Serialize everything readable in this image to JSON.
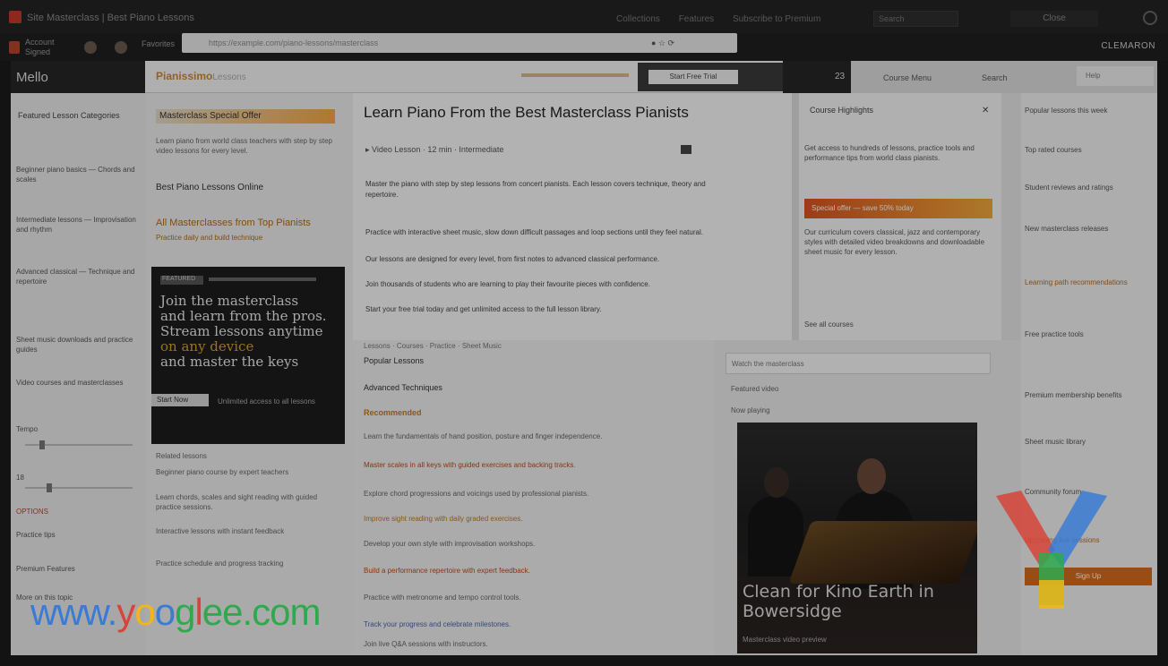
{
  "browser": {
    "tab_title": "Site Masterclass | Best Piano Lessons",
    "top_links": [
      "Collections",
      "Features",
      "Subscribe to Premium"
    ],
    "search_text": "Search",
    "right_button": "Close",
    "user_label": "Account",
    "user_sub": "Signed",
    "crumb": "Favorites",
    "url_text": "https://example.com/piano-lessons/masterclass",
    "url_icons": "● ☆ ⟳",
    "brand_right": "CLEMARON"
  },
  "nav": {
    "menu_label": "Mello",
    "right_link_1": "Course Menu",
    "right_link_2": "Search",
    "right_box": "Help",
    "number": "23"
  },
  "site_header": {
    "logo": "Pianissimo",
    "logo_tag": "Lessons",
    "button": "Start Free Trial"
  },
  "left_sidebar": {
    "title": "Featured Lesson Categories",
    "items": [
      "Beginner piano basics — Chords and scales",
      "Intermediate lessons — Improvisation and rhythm",
      "Advanced classical — Technique and repertoire",
      "Sheet music downloads and practice guides",
      "Video courses and masterclasses",
      "Tempo",
      "18",
      "OPTIONS",
      "Practice tips",
      "Premium Features",
      "More on this topic"
    ]
  },
  "col2": {
    "highlight": "Masterclass Special Offer",
    "para1": "Learn piano from world class teachers with step by step video lessons for every level.",
    "sub1": "Best Piano Lessons Online",
    "sub2": "All Masterclasses from Top Pianists",
    "sub2_detail": "Practice daily and build technique",
    "promo_badge": "FEATURED",
    "promo_title_1": "Join the masterclass",
    "promo_title_2": "and learn from the pros.",
    "promo_title_3": "Stream lessons anytime",
    "promo_highlight": "on any device",
    "promo_title_4": "and master the keys",
    "promo_tag": "Start Now",
    "promo_foot": "Unlimited access to all lessons",
    "footer_items": [
      "Related lessons",
      "Beginner piano course by expert teachers",
      "Learn chords, scales and sight reading with guided practice sessions.",
      "Interactive lessons with instant feedback",
      "Practice schedule and progress tracking"
    ]
  },
  "main": {
    "headline": "Learn Piano From the Best Masterclass Pianists",
    "meta": "▸ Video Lesson · 12 min · Intermediate",
    "paragraphs": [
      "Master the piano with step by step lessons from concert pianists. Each lesson covers technique, theory and repertoire.",
      "Practice with interactive sheet music, slow down difficult passages and loop sections until they feel natural.",
      "Our lessons are designed for every level, from first notes to advanced classical performance.",
      "Join thousands of students who are learning to play their favourite pieces with confidence.",
      "Start your free trial today and get unlimited access to the full lesson library."
    ]
  },
  "promo_panel": {
    "title": "Course Highlights",
    "close": "✕",
    "para1": "Get access to hundreds of lessons, practice tools and performance tips from world class pianists.",
    "bar_text": "Special offer — save 50% today",
    "para2": "Our curriculum covers classical, jazz and contemporary styles with detailed video breakdowns and downloadable sheet music for every lesson.",
    "foot": "See all courses"
  },
  "right_sidebar": {
    "items": [
      "Popular lessons this week",
      "Top rated courses",
      "Student reviews and ratings",
      "New masterclass releases",
      "Learning path recommendations",
      "Free practice tools",
      "Premium membership benefits",
      "Sheet music library",
      "Community forum",
      "Upcoming live sessions"
    ],
    "cta": "Sign Up"
  },
  "lower": {
    "tab_row": "Lessons · Courses · Practice · Sheet Music",
    "sub1": "Popular Lessons",
    "sub2": "Advanced Techniques",
    "sub3": "Recommended",
    "lines": [
      "Learn the fundamentals of hand position, posture and finger independence.",
      "Master scales in all keys with guided exercises and backing tracks.",
      "Explore chord progressions and voicings used by professional pianists.",
      "Improve sight reading with daily graded exercises.",
      "Develop your own style with improvisation workshops.",
      "Build a performance repertoire with expert feedback.",
      "Practice with metronome and tempo control tools.",
      "Track your progress and celebrate milestones.",
      "Join live Q&A sessions with instructors."
    ]
  },
  "col5": {
    "box_text": "Watch the masterclass",
    "label1": "Featured video",
    "label2": "Now playing",
    "photo_caption": "Clean for Kino Earth in Bowersidge",
    "photo_credit": "Masterclass video preview"
  },
  "watermark": {
    "text_parts": [
      "www.",
      "y",
      "o",
      "o",
      "g",
      "l",
      "ee.com"
    ]
  },
  "colors": {
    "accent": "#d56b1d",
    "highlight": "#f4a642"
  }
}
